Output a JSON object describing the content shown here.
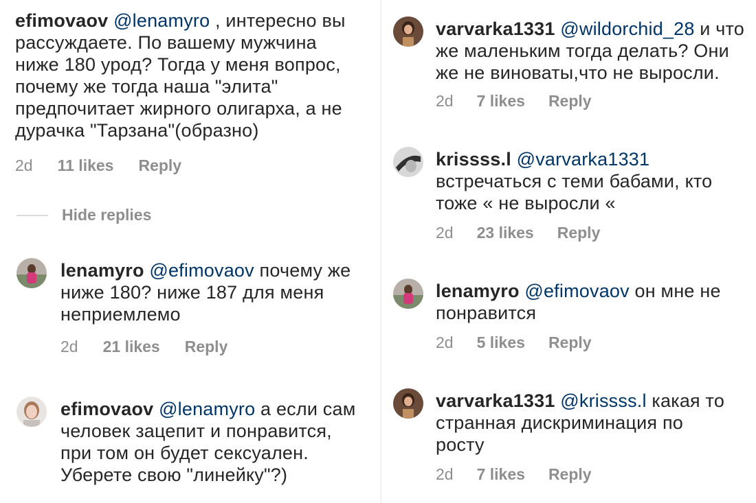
{
  "left": {
    "top_comment": {
      "username": "efimovaov",
      "mention": "@lenamyro",
      "text_lines": [
        " , интересно вы",
        "рассуждаете. По вашему мужчина",
        "ниже 180 урод? Тогда у меня вопрос,",
        "почему же тогда  наша \"элита\"",
        "предпочитает жирного олигарха, а не",
        "дурачка \"Тарзана\"(образно)"
      ],
      "time": "2d",
      "likes": "11 likes",
      "reply": "Reply"
    },
    "hide_replies": "Hide replies",
    "replies": [
      {
        "username": "lenamyro",
        "mention": "@efimovaov",
        "line1_rest": " почему же",
        "lines": [
          "ниже 180? ниже 187 для меня",
          "неприемлемо"
        ],
        "time": "2d",
        "likes": "21 likes",
        "reply": "Reply"
      },
      {
        "username": "efimovaov",
        "mention": "@lenamyro",
        "line1_rest": " а если сам",
        "lines": [
          "человек зацепит и понравится,",
          "при том он будет сексуален.",
          "Уберете свою \"линейку\"?)"
        ]
      }
    ]
  },
  "right": {
    "comments": [
      {
        "username": "varvarka1331",
        "mention": "@wildorchid_28",
        "line1_rest": " и что",
        "lines": [
          "же маленьким тогда делать? Они",
          "же не виноваты,что не выросли."
        ],
        "time": "2d",
        "likes": "7 likes",
        "reply": "Reply"
      },
      {
        "username": "krissss.l",
        "mention": "@varvarka1331",
        "line1_rest": "",
        "lines": [
          "встречаться с теми бабами, кто",
          "тоже « не выросли «"
        ],
        "time": "2d",
        "likes": "23 likes",
        "reply": "Reply"
      },
      {
        "username": "lenamyro",
        "mention": "@efimovaov",
        "line1_rest": " он мне не",
        "lines": [
          "понравится"
        ],
        "time": "2d",
        "likes": "5 likes",
        "reply": "Reply"
      },
      {
        "username": "varvarka1331",
        "mention": "@krissss.l",
        "line1_rest": " какая то",
        "lines": [
          "странная дискриминация по",
          "росту"
        ],
        "time": "2d",
        "likes": "7 likes",
        "reply": "Reply"
      }
    ]
  },
  "colors": {
    "text": "#262626",
    "meta": "#8e8e8e",
    "mention": "#003569"
  }
}
